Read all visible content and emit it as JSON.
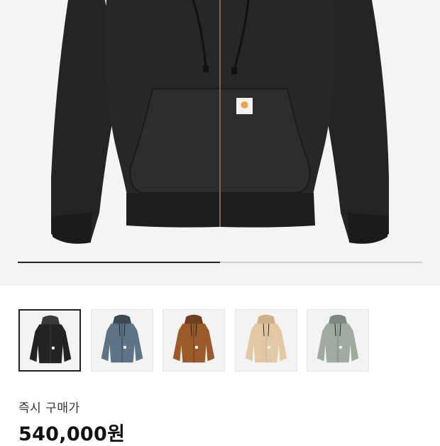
{
  "product": {
    "price_label": "즉시 구매가",
    "price_value": "540,000원",
    "brand_patch_color": "#e8a44a"
  },
  "gallery": {
    "progress": 0.5,
    "thumbnails": [
      {
        "name": "black",
        "color": "#232323",
        "hood": "#3a3a3a",
        "selected": true
      },
      {
        "name": "blue-grey",
        "color": "#5c7486",
        "hood": "#3b4a55",
        "selected": false
      },
      {
        "name": "hamilton-brown",
        "color": "#9a5a2a",
        "hood": "#6e3e1d",
        "selected": false
      },
      {
        "name": "dusty-beige",
        "color": "#e3c9a3",
        "hood": "#cfb089",
        "selected": false
      },
      {
        "name": "sage-grey",
        "color": "#a1aaa0",
        "hood": "#7f887e",
        "selected": false
      }
    ]
  }
}
